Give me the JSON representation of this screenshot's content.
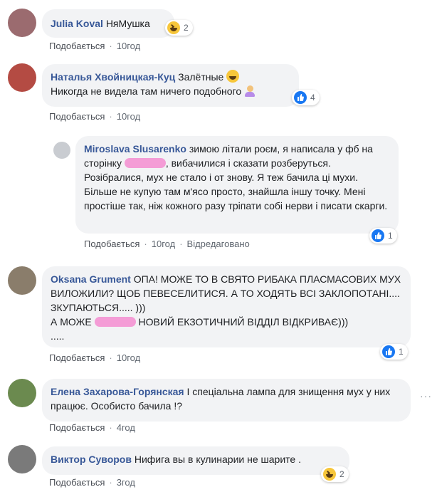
{
  "actions": {
    "like_label": "Подобається",
    "edited_label": "Відредаговано"
  },
  "comments": [
    {
      "author": "Julia Koval",
      "text": "НяМушка",
      "time": "10год",
      "reaction": "haha",
      "reaction_count": "2",
      "avatar_color": "#9b6b6f"
    },
    {
      "author": "Наталья Хвойницкая-Куц",
      "text1": "Залётные",
      "text2": "Никогда не видела там ничего подобного",
      "time": "10год",
      "reaction": "like",
      "reaction_count": "4",
      "avatar_color": "#b44b43"
    },
    {
      "author": "Miroslava Slusarenko",
      "text_a": "зимою літали роєм, я написала у фб на сторінку",
      "text_b": ", вибачилися і сказати розберуться. Розібралися, мух не стало і от знову. Я теж бачила ці мухи. Більше не купую там м'ясо просто, знайшла іншу точку. Мені простіше так, ніж кожного разу тріпати собі нерви і писати скарги.",
      "time": "10год",
      "reaction": "like",
      "reaction_count": "1",
      "avatar_color": "#c9ccd1"
    },
    {
      "author": "Oksana Grument",
      "text_a": "ОПА! МОЖЕ ТО В СВЯТО РИБАКА ПЛАСМАСОВИХ МУХ ВИЛОЖИЛИ? ЩОБ ПЕВЕСЕЛИТИСЯ. А ТО ХОДЯТЬ ВСІ ЗАКЛОПОТАНІ.... ЗКУПАЮТЬСЯ..... )))",
      "text_b": "А МОЖЕ",
      "text_c": "НОВИЙ ЕКЗОТИЧНИЙ ВІДДІЛ ВІДКРИВАЄ)))",
      "text_d": ".....",
      "time": "10год",
      "reaction": "like",
      "reaction_count": "1",
      "avatar_color": "#8a7d6b"
    },
    {
      "author": "Елена Захарова-Горянская",
      "text": "І спеціальна лампа для знищення мух у них працює. Особисто бачила !?",
      "time": "4год",
      "more": "···",
      "avatar_color": "#6b8a4f"
    },
    {
      "author": "Виктор Суворов",
      "text": "Нифига вы в кулинарии не шарите .",
      "time": "3год",
      "reaction": "haha",
      "reaction_count": "2",
      "avatar_color": "#7a7a7a"
    }
  ]
}
